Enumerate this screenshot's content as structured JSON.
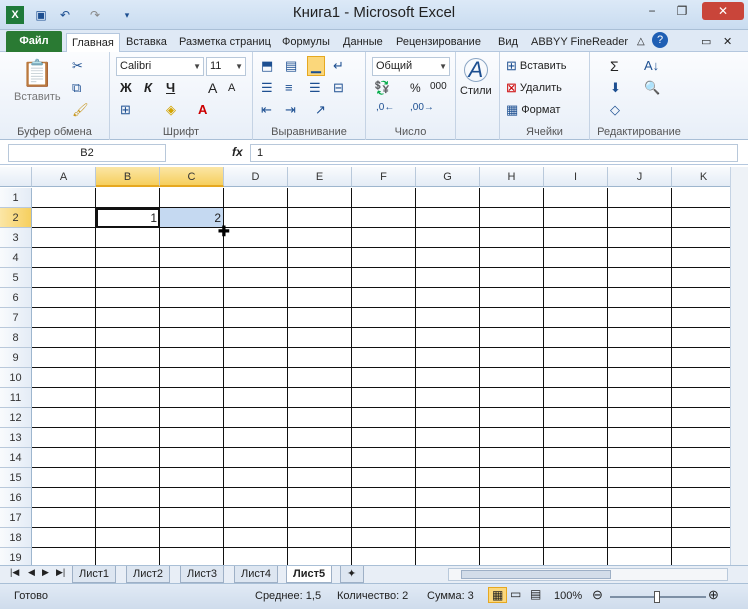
{
  "window": {
    "title": "Книга1  -  Microsoft Excel",
    "minimize": "−",
    "restore": "❐",
    "close": "✕"
  },
  "qat": [
    "excel-logo",
    "save",
    "undo",
    "redo",
    "customize"
  ],
  "tabs": [
    {
      "label": "Файл"
    },
    {
      "label": "Главная"
    },
    {
      "label": "Вставка"
    },
    {
      "label": "Разметка страниц"
    },
    {
      "label": "Формулы"
    },
    {
      "label": "Данные"
    },
    {
      "label": "Рецензирование"
    },
    {
      "label": "Вид"
    },
    {
      "label": "ABBYY FineReader"
    }
  ],
  "ribbon": {
    "clipboard": {
      "label": "Буфер обмена",
      "paste": "Вставить"
    },
    "font": {
      "label": "Шрифт",
      "name": "Calibri",
      "size": "11",
      "bold": "Ж",
      "italic": "К",
      "underline": "Ч",
      "grow": "A",
      "shrink": "A"
    },
    "align": {
      "label": "Выравнивание"
    },
    "number": {
      "label": "Число",
      "format": "Общий",
      "percent": "%",
      "thousands": "000"
    },
    "styles": {
      "label": "Стили"
    },
    "cells": {
      "label": "Ячейки",
      "insert": "Вставить",
      "delete": "Удалить",
      "format": "Формат"
    },
    "edit": {
      "label": "Редактирование"
    }
  },
  "formula_bar": {
    "name_box": "B2",
    "fx": "fx",
    "value": "1"
  },
  "grid": {
    "columns": [
      "A",
      "B",
      "C",
      "D",
      "E",
      "F",
      "G",
      "H",
      "I",
      "J",
      "K"
    ],
    "selected_columns": [
      "B",
      "C"
    ],
    "rows": [
      "1",
      "2",
      "3",
      "4",
      "5",
      "6",
      "7",
      "8",
      "9",
      "10",
      "11",
      "12",
      "13",
      "14",
      "15",
      "16",
      "17",
      "18",
      "19"
    ],
    "selected_row": "2",
    "cells": {
      "B2": "1",
      "C2": "2"
    }
  },
  "sheets": [
    "Лист1",
    "Лист2",
    "Лист3",
    "Лист4",
    "Лист5"
  ],
  "active_sheet": "Лист5",
  "status": {
    "ready": "Готово",
    "average": "Среднее: 1,5",
    "count": "Количество: 2",
    "sum": "Сумма: 3",
    "zoom": "100%"
  },
  "colors": {
    "file_tab": "#2a7a33",
    "selection": "#c5d9f1",
    "header_selected": "#f6cf5e"
  }
}
